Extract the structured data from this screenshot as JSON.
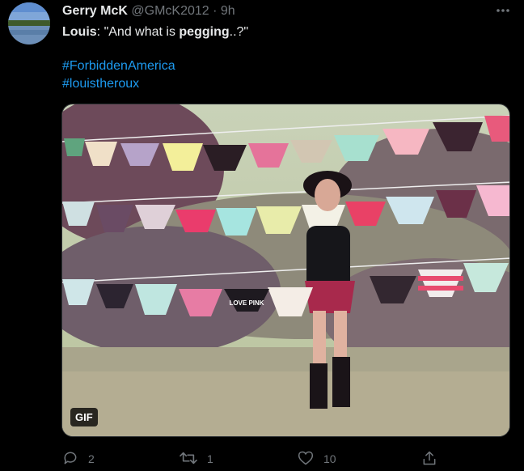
{
  "tweet": {
    "author_name": "Gerry McK",
    "author_handle": "@GMcK2012",
    "separator": "·",
    "time": "9h",
    "text_speaker": "Louis",
    "text_before": ": \"And what is ",
    "text_bold": "pegging",
    "text_after": "..?\"",
    "hashtags": [
      "#ForbiddenAmerica",
      "#louistheroux"
    ],
    "media_badge": "GIF",
    "media_caption_text": "LOVE PINK",
    "reply_count": "2",
    "retweet_count": "1",
    "like_count": "10"
  },
  "icons": {
    "more": "more-dots-icon",
    "reply": "reply-icon",
    "retweet": "retweet-icon",
    "like": "heart-icon",
    "share": "share-icon"
  },
  "colors": {
    "background": "#000000",
    "text": "#e7e9ea",
    "secondary": "#71767b",
    "link": "#1d9bf0"
  }
}
